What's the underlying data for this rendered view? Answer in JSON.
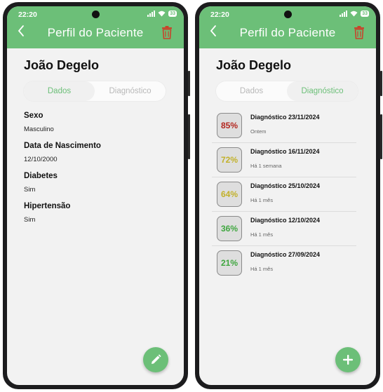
{
  "status": {
    "time": "22:20",
    "battery": "33"
  },
  "header": {
    "title": "Perfil do Paciente",
    "back_icon": "chevron-left-icon",
    "delete_icon": "trash-icon"
  },
  "patient": {
    "name": "João Degelo"
  },
  "tabs": [
    {
      "label": "Dados"
    },
    {
      "label": "Diagnóstico"
    }
  ],
  "fields": [
    {
      "label": "Sexo",
      "value": "Masculino"
    },
    {
      "label": "Data de Nascimento",
      "value": "12/10/2000"
    },
    {
      "label": "Diabetes",
      "value": "Sim"
    },
    {
      "label": "Hipertensão",
      "value": "Sim"
    }
  ],
  "diagnostics": [
    {
      "score": "85%",
      "title": "Diagnóstico 23/11/2024",
      "subtitle": "Ontem",
      "color": "#b3261e"
    },
    {
      "score": "72%",
      "title": "Diagnóstico 16/11/2024",
      "subtitle": "Há 1 semana",
      "color": "#c2b12a"
    },
    {
      "score": "64%",
      "title": "Diagnóstico 25/10/2024",
      "subtitle": "Há 1 mês",
      "color": "#c2b12a"
    },
    {
      "score": "36%",
      "title": "Diagnóstico 12/10/2024",
      "subtitle": "Há 1 mês",
      "color": "#3fa63f"
    },
    {
      "score": "21%",
      "title": "Diagnóstico 27/09/2024",
      "subtitle": "Há 1 mês",
      "color": "#3fa63f"
    }
  ],
  "colors": {
    "accent": "#6cbf78",
    "danger": "#c8432b",
    "background": "#f2f2f2"
  },
  "fab": {
    "edit_icon": "pencil-icon",
    "add_icon": "plus-icon"
  }
}
